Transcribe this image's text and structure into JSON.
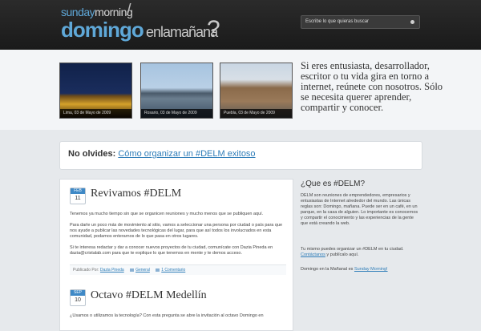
{
  "header": {
    "logo_top_a": "sunday",
    "logo_top_b": "morning",
    "logo_slash": "/",
    "logo_main": "domingo",
    "logo_sub": "enlamañana",
    "logo_q": "?",
    "search_placeholder": "Escribe lo que quieras buscar"
  },
  "features": {
    "photos": [
      {
        "caption": "Lima, 03 de Mayo de 2009"
      },
      {
        "caption": "Rosario, 03 de Mayo de 2009"
      },
      {
        "caption": "Puebla, 03 de Mayo de 2009"
      }
    ],
    "tagline": "Si eres entusiasta, desarrollador, escritor o tu vida gira en torno a internet, reúnete con nosotros. Sólo se necesita querer aprender, compartir y conocer."
  },
  "notice": {
    "label": "No olvides:",
    "link": "Cómo organizar un #DELM exitoso"
  },
  "posts": [
    {
      "month": "FEB",
      "day": "11",
      "title": "Revivamos #DELM",
      "paragraphs": [
        "Tenemos ya mucho tiempo sin que se organicen reuniones y mucho menos que se publiquen aquí.",
        "Para darle un poco más de movimiento al sitio, vamos a seleccionar una persona por ciudad o país para que nos ayude a publicar las novedades tecnológicas del lugar, para que así todos los involucrados en esta comunidad, podamos enterarnos de lo que pasa en otros lugares.",
        "Si te interesa redactar y dar a conocer nuevos proyectos de tu ciudad, comunícate con Dazia Pineda en dazia@cristalab.com para que te explique lo que tenemos en mente y te demos acceso."
      ],
      "meta": {
        "published_by": "Publicado Por:",
        "author": "Dazia Pineda",
        "category": "General",
        "comments": "1 Comentario"
      }
    },
    {
      "month": "SEP",
      "day": "10",
      "title": "Octavo #DELM Medellín",
      "paragraphs": [
        "¿Usamos o utilizamos la tecnología? Con esta pregunta se abre la invitación al octavo Domingo en"
      ]
    }
  ],
  "sidebar": {
    "title": "¿Que es #DELM?",
    "para1": "DELM son reuniones de emprendedores, empresarios y entusiastas de Internet alrededor del mundo. Las únicas reglas son: Domingo, mañana. Puede ser en un café, en un parque, en la casa de alguien. Lo importante es conocernos y compartir el conocimiento y las experiencias de la gente que está creando la web.",
    "para2_text": "Tu mismo puedes organizar un #DELM en tu ciudad.",
    "para2_link": "Contáctanos",
    "para2_tail": " y publícalo aquí.",
    "para3_text": "Domingo en la Mañanal es ",
    "para3_link": "Sunday Morning!"
  },
  "colors": {
    "accent": "#3f89c6",
    "link": "#2e7db8",
    "header_bg": "#1f1f1f"
  }
}
